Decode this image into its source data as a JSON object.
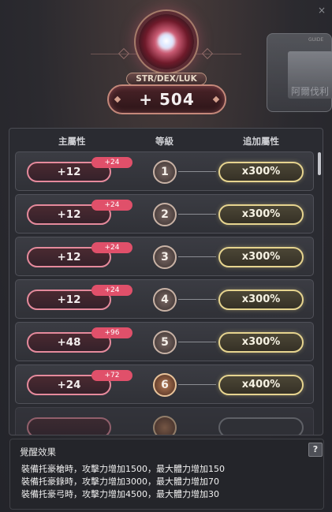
{
  "window": {
    "close_label": "×"
  },
  "background": {
    "small_text": "GUIDE",
    "card_text": "阿爾伐利"
  },
  "header": {
    "stat_label": "STR/DEX/LUK",
    "stat_total": "+ 504"
  },
  "table": {
    "columns": [
      "主屬性",
      "等級",
      "追加屬性"
    ],
    "rows": [
      {
        "main": "+12",
        "bonus": "+24",
        "level": "1",
        "extra": "x300%"
      },
      {
        "main": "+12",
        "bonus": "+24",
        "level": "2",
        "extra": "x300%"
      },
      {
        "main": "+12",
        "bonus": "+24",
        "level": "3",
        "extra": "x300%"
      },
      {
        "main": "+12",
        "bonus": "+24",
        "level": "4",
        "extra": "x300%"
      },
      {
        "main": "+48",
        "bonus": "+96",
        "level": "5",
        "extra": "x300%"
      },
      {
        "main": "+24",
        "bonus": "+72",
        "level": "6",
        "extra": "x400%"
      }
    ]
  },
  "awakening": {
    "title": "覺醒效果",
    "help_label": "?",
    "lines": [
      "裝備托豪槍時，攻擊力增加1500，最大體力增加150",
      "裝備托豪錄時，攻擊力增加3000，最大體力增加70",
      "裝備托豪弓時，攻擊力增加4500，最大體力增加30"
    ]
  },
  "colors": {
    "main_pill_border": "#e58a9c",
    "bonus_badge": "#e0506a",
    "extra_pill_border": "#e6d48f"
  }
}
